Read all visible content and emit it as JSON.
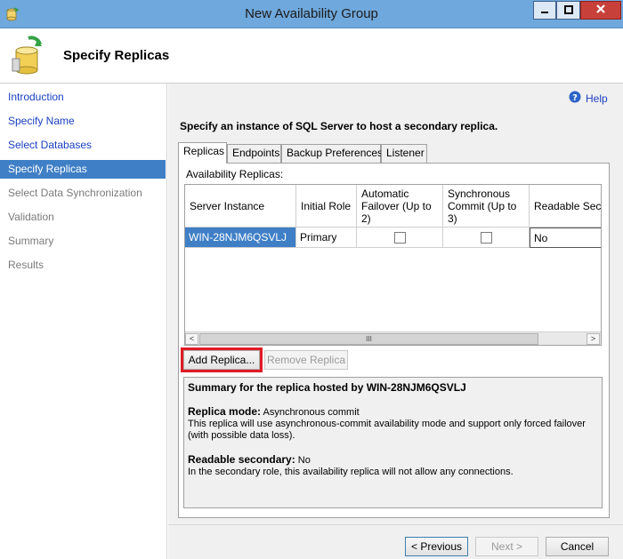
{
  "window": {
    "title": "New Availability Group",
    "controls": [
      "minimize-icon",
      "maximize-icon",
      "close-icon"
    ]
  },
  "header": {
    "title": "Specify Replicas",
    "icon": "database-sync-icon"
  },
  "sidebar": {
    "items": [
      {
        "label": "Introduction",
        "state": "link"
      },
      {
        "label": "Specify Name",
        "state": "link"
      },
      {
        "label": "Select Databases",
        "state": "link"
      },
      {
        "label": "Specify Replicas",
        "state": "active"
      },
      {
        "label": "Select Data Synchronization",
        "state": "disabled"
      },
      {
        "label": "Validation",
        "state": "disabled"
      },
      {
        "label": "Summary",
        "state": "disabled"
      },
      {
        "label": "Results",
        "state": "disabled"
      }
    ]
  },
  "help": {
    "label": "Help",
    "icon": "help-icon"
  },
  "main": {
    "instruction": "Specify an instance of SQL Server to host a secondary replica.",
    "tabs": [
      {
        "label": "Replicas",
        "active": true
      },
      {
        "label": "Endpoints",
        "active": false
      },
      {
        "label": "Backup Preferences",
        "active": false
      },
      {
        "label": "Listener",
        "active": false
      }
    ],
    "replicas_label": "Availability Replicas:",
    "grid": {
      "columns": [
        "Server Instance",
        "Initial Role",
        "Automatic Failover (Up to 2)",
        "Synchronous Commit (Up to 3)",
        "Readable Secon"
      ],
      "rows": [
        {
          "server_instance": "WIN-28NJM6QSVLJ",
          "initial_role": "Primary",
          "automatic_failover": false,
          "synchronous_commit": false,
          "readable_secondary": "No"
        }
      ],
      "scroll_thumb_glyph": "III",
      "scroll_left_glyph": "<",
      "scroll_right_glyph": ">"
    },
    "buttons": {
      "add_replica": "Add Replica...",
      "remove_replica": "Remove Replica"
    },
    "summary": {
      "title": "Summary for the replica hosted by WIN-28NJM6QSVLJ",
      "replica_mode_label": "Replica mode:",
      "replica_mode_value": "Asynchronous commit",
      "replica_mode_desc": "This replica will use asynchronous-commit availability mode and support only forced failover (with possible data loss).",
      "readable_label": "Readable secondary:",
      "readable_value": "No",
      "readable_desc": "In the secondary role, this availability replica will not allow any connections."
    }
  },
  "footer": {
    "previous": "< Previous",
    "next": "Next >",
    "cancel": "Cancel"
  },
  "colors": {
    "titlebar": "#6fa8dc",
    "selection": "#3f7fc6",
    "link": "#1a3fc2",
    "highlight": "#e01b24",
    "close_button": "#c7413a"
  }
}
